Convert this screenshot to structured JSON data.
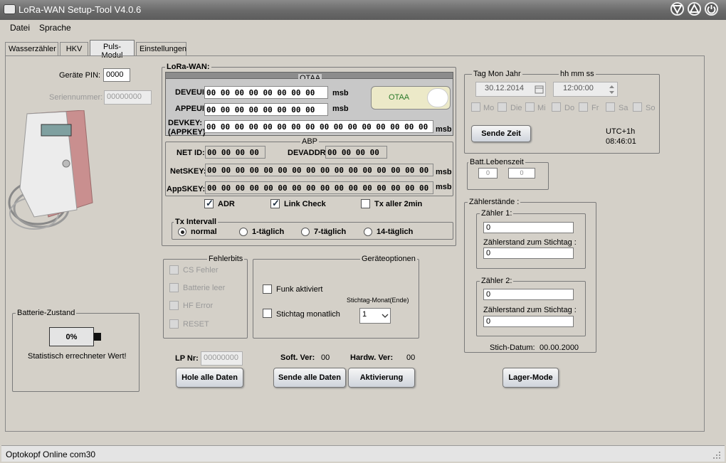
{
  "window": {
    "title": "LoRa-WAN Setup-Tool V4.0.6"
  },
  "menu": [
    "Datei",
    "Sprache"
  ],
  "tabs": [
    "Wasserzähler",
    "HKV",
    "Puls-Modul",
    "Einstellungen"
  ],
  "device": {
    "pin_label": "Geräte PIN:",
    "pin_value": "0000",
    "serial_label": "Seriennummer:",
    "serial_value": "00000000",
    "image_text": "Pulse-Modul device"
  },
  "lorawan": {
    "group_label": "LoRa-WAN:",
    "otaa": {
      "title": "OTAA",
      "deveui_label": "DEVEUI:",
      "deveui_value": "00 00 00 00 00 00 00 00",
      "appeui_label": "APPEUI:",
      "appeui_value": "00 00 00 00 00 00 00 00",
      "devkey_label1": "DEVKEY:",
      "devkey_label2": "(APPKEY)",
      "devkey_value": "00 00 00 00 00 00 00 00 00 00 00 00 00 00 00 00",
      "msb": "msb",
      "toggle_label": "OTAA"
    },
    "abp": {
      "title": "ABP",
      "netid_label": "NET ID:",
      "netid_value": "00 00 00 00",
      "devaddr_label": "DEVADDR:",
      "devaddr_value": "00 00 00 00",
      "netskey_label": "NetSKEY:",
      "netskey_value": "00 00 00 00 00 00 00 00 00 00 00 00 00 00 00 00",
      "appskey_label": "AppSKEY:",
      "appskey_value": "00 00 00 00 00 00 00 00 00 00 00 00 00 00 00 00",
      "msb": "msb"
    },
    "adr_label": "ADR",
    "linkcheck_label": "Link Check",
    "tx2min_label": "Tx aller 2min",
    "tx_interval": {
      "label": "Tx Intervall",
      "options": [
        "normal",
        "1-täglich",
        "7-täglich",
        "14-täglich"
      ]
    }
  },
  "fehlerbits": {
    "title": "Fehlerbits",
    "items": [
      "CS Fehler",
      "Batterie leer",
      "HF Error",
      "RESET"
    ]
  },
  "geraeteoptionen": {
    "title": "Geräteoptionen",
    "funk_label": "Funk aktiviert",
    "stichtag_label": "Stichtag monatlich",
    "monat_label": "Stichtag-Monat(Ende)",
    "monat_value": "1"
  },
  "battery": {
    "title": "Batterie-Zustand",
    "percent": "0%",
    "note": "Statistisch errechneter Wert!"
  },
  "bottom": {
    "lp_label": "LP Nr:",
    "lp_value": "00000000",
    "soft_label": "Soft. Ver:",
    "soft_value": "00",
    "hard_label": "Hardw. Ver:",
    "hard_value": "00",
    "hole_button": "Hole alle Daten",
    "sende_button": "Sende alle Daten",
    "aktivierung_button": "Aktivierung",
    "lager_button": "Lager-Mode"
  },
  "time": {
    "header_date": "Tag  Mon  Jahr",
    "header_time": "hh  mm  ss",
    "date_value": "30.12.2014",
    "time_value": "12:00:00",
    "days": [
      "Mo",
      "Die",
      "Mi",
      "Do",
      "Fr",
      "Sa",
      "So"
    ],
    "sende_zeit": "Sende Zeit",
    "utc": "UTC+1h",
    "clock": "08:46:01"
  },
  "batt_life": {
    "title": "Batt.Lebenszeit",
    "val1": "0",
    "val2": "0"
  },
  "zaehler": {
    "title": "Zählerstände :",
    "z1_title": "Zähler 1:",
    "z1_value": "0",
    "z1_stichtag_label": "Zählerstand zum Stichtag :",
    "z1_stichtag_value": "0",
    "z2_title": "Zähler 2:",
    "z2_value": "0",
    "z2_stichtag_label": "Zählerstand zum Stichtag :",
    "z2_stichtag_value": "0",
    "stich_datum_label": "Stich-Datum:",
    "stich_datum_value": "00.00.2000"
  },
  "statusbar": {
    "text": "Optokopf Online com30"
  }
}
